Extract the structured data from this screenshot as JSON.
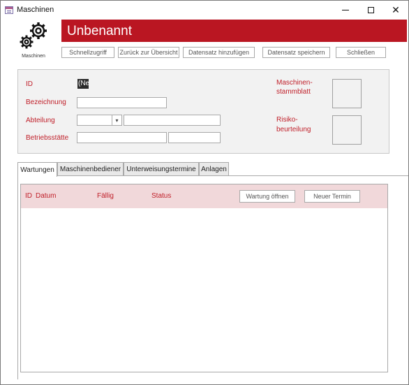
{
  "window": {
    "title": "Maschinen",
    "close_glyph": "✕"
  },
  "header": {
    "logo_label": "Maschinen",
    "logo_icon": "gears-icon",
    "title": "Unbenannt",
    "banner_color": "#ba1622"
  },
  "toolbar": {
    "quick_access": "Schnellzugriff",
    "back_overview": "Zurück zur Übersicht",
    "add_record": "Datensatz hinzufügen",
    "save_record": "Datensatz speichern",
    "close": "Schließen"
  },
  "form": {
    "id_label": "ID",
    "id_value": "(Ne",
    "bezeichnung_label": "Bezeichnung",
    "bezeichnung_value": "",
    "abteilung_label": "Abteilung",
    "abteilung_value": "",
    "abteilung_name": "",
    "betriebsstaette_label": "Betriebsstätte",
    "betriebsstaette_value": "",
    "betriebsstaette_extra": "",
    "maschinen_label_1": "Maschinen-",
    "maschinen_label_2": "stammblatt",
    "risiko_label_1": "Risiko-",
    "risiko_label_2": "beurteilung"
  },
  "tabs": [
    {
      "label": "Wartungen",
      "active": true
    },
    {
      "label": "Maschinenbediener",
      "active": false
    },
    {
      "label": "Unterweisungstermine",
      "active": false
    },
    {
      "label": "Anlagen",
      "active": false
    }
  ],
  "wartungen": {
    "columns": [
      "ID",
      "Datum",
      "Fällig",
      "Status"
    ],
    "open_button": "Wartung öffnen",
    "new_button": "Neuer Termin",
    "rows": []
  },
  "colors": {
    "accent": "#ba1622",
    "label_red": "#c0202a",
    "subheader_bg": "#f1d8da"
  }
}
